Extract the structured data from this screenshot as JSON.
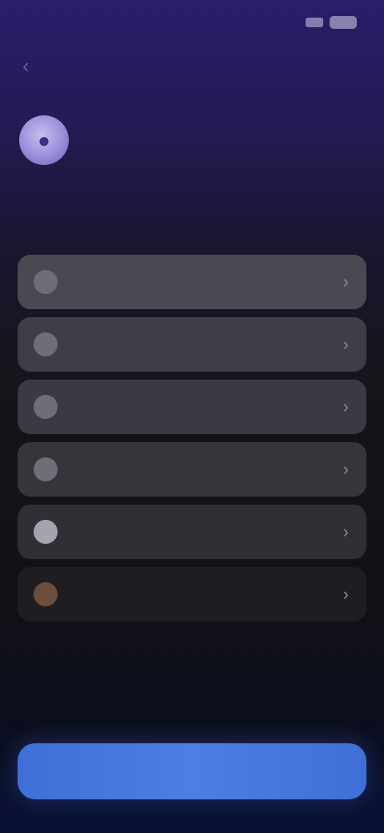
{
  "status_bar": {
    "time": "",
    "signal_icon": "signal-icon",
    "battery_icon": "battery-icon"
  },
  "nav": {
    "back_label": ""
  },
  "header": {
    "avatar_icon": "person-icon",
    "title": "",
    "subtitle": ""
  },
  "list": {
    "items": [
      {
        "label": "",
        "icon": "option-icon"
      },
      {
        "label": "",
        "icon": "option-icon"
      },
      {
        "label": "",
        "icon": "option-icon"
      },
      {
        "label": "",
        "icon": "option-icon"
      },
      {
        "label": "",
        "icon": "option-icon"
      },
      {
        "label": "",
        "icon": "option-icon"
      }
    ]
  },
  "footer": {
    "continue_label": ""
  },
  "colors": {
    "accent": "#4c7ee6",
    "background_top": "#2a1d6b",
    "background_bottom": "#0a1136"
  }
}
